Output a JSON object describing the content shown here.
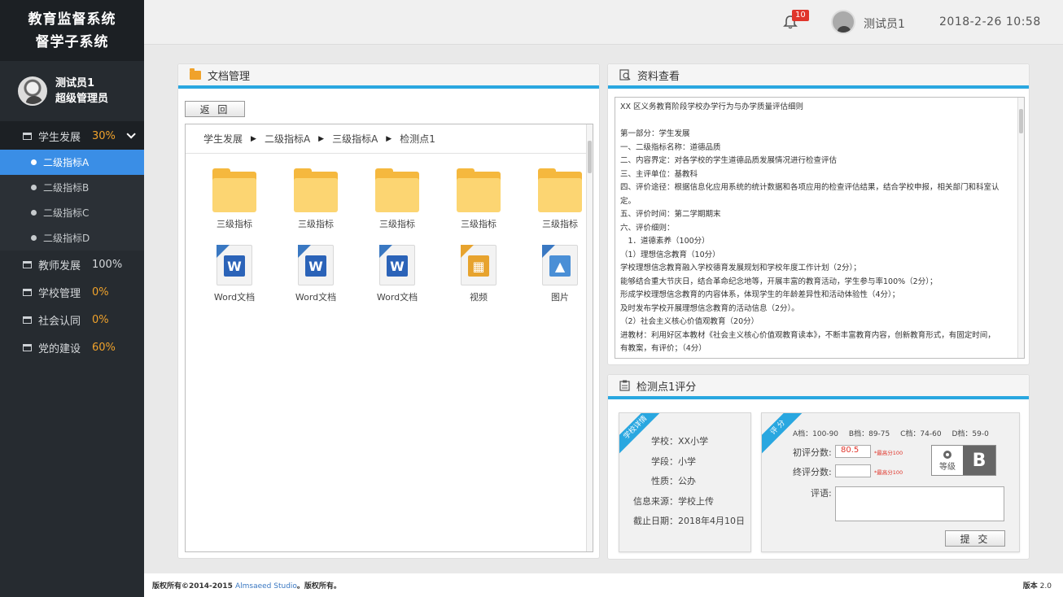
{
  "app": {
    "title_line1": "教育监督系统",
    "title_line2": "督学子系统"
  },
  "user": {
    "name": "测试员1",
    "role": "超级管理员"
  },
  "sidebar": {
    "items": [
      {
        "label": "学生发展",
        "percent": "30%"
      },
      {
        "label": "教师发展",
        "percent": "100%"
      },
      {
        "label": "学校管理",
        "percent": "0%"
      },
      {
        "label": "社会认同",
        "percent": "0%"
      },
      {
        "label": "党的建设",
        "percent": "60%"
      }
    ],
    "sub_items": [
      {
        "label": "二级指标A"
      },
      {
        "label": "二级指标B"
      },
      {
        "label": "二级指标C"
      },
      {
        "label": "二级指标D"
      }
    ]
  },
  "header": {
    "notification_count": "10",
    "user_name": "测试员1",
    "datetime": "2018-2-26  10:58"
  },
  "doc_manager": {
    "title": "文档管理",
    "back_label": "返 回",
    "breadcrumb": [
      "学生发展",
      "二级指标A",
      "三级指标A",
      "检测点1"
    ],
    "breadcrumb_sep": "▶",
    "files": [
      {
        "label": "三级指标",
        "icon": "folder-icon"
      },
      {
        "label": "三级指标",
        "icon": "folder-icon"
      },
      {
        "label": "三级指标",
        "icon": "folder-icon"
      },
      {
        "label": "三级指标",
        "icon": "folder-icon"
      },
      {
        "label": "三级指标",
        "icon": "folder-icon"
      },
      {
        "label": "Word文档",
        "icon": "word-doc-icon"
      },
      {
        "label": "Word文档",
        "icon": "word-doc-icon"
      },
      {
        "label": "Word文档",
        "icon": "word-doc-icon"
      },
      {
        "label": "视频",
        "icon": "video-file-icon"
      },
      {
        "label": "图片",
        "icon": "image-file-icon"
      }
    ]
  },
  "viewer": {
    "title": "资料查看",
    "lines": [
      "XX 区义务教育阶段学校办学行为与办学质量评估细则",
      "",
      "第一部分：学生发展",
      "一、二级指标名称：道德品质",
      "二、内容界定：对各学校的学生道德品质发展情况进行检查评估",
      "三、主评单位：基教科",
      "四、评价途径：根据信息化应用系统的统计数据和各项应用的检查评估结果，结合学校申报，相关部门和科室认定。",
      "五、评价时间：第二学期期末",
      "六、评价细则：",
      "　1．道德素养（100分）",
      "（1）理想信念教育（10分）",
      "学校理想信念教育融入学校德育发展规划和学校年度工作计划（2分）；",
      "能够结合重大节庆日，结合革命纪念地等，开展丰富的教育活动，学生参与率100%（2分）；",
      "形成学校理想信念教育的内容体系，体现学生的年龄差异性和活动体验性（4分）；",
      "及时发布学校开展理想信念教育的活动信息（2分）。",
      "（2）社会主义核心价值观教育（20分）",
      "进教材：利用好区本教材《社会主义核心价值观教育读本》，不断丰富教育内容，创新教育形式，有固定时间，",
      "有教案，有评价；（4分）"
    ]
  },
  "evaluation": {
    "title": "检测点1评分",
    "info_ribbon": "学校详情",
    "info": [
      {
        "key": "学校：",
        "value": "XX小学"
      },
      {
        "key": "学段：",
        "value": "小学"
      },
      {
        "key": "性质：",
        "value": "公办"
      },
      {
        "key": "信息来源：",
        "value": "学校上传"
      },
      {
        "key": "截止日期：",
        "value": "2018年4月10日"
      }
    ],
    "eval_ribbon": "评 分",
    "grades": [
      "A档：100-90",
      "B档：89-75",
      "C档：74-60",
      "D档：59-0"
    ],
    "initial_label": "初评分数:",
    "initial_value": "80.5",
    "initial_hint": "*最高分100",
    "final_label": "终评分数:",
    "final_value": "",
    "final_hint": "*最高分100",
    "level_label": "等级",
    "level_value": "B",
    "comment_label": "评语:",
    "submit_label": "提 交"
  },
  "footer": {
    "copyright_prefix": "版权所有©2014-2015 ",
    "studio": "Almsaeed Studio",
    "copyright_suffix": "。版权所有。",
    "version_label": "版本",
    "version": "2.0"
  },
  "colors": {
    "accent": "#29a7e0",
    "selected": "#3a8ee6",
    "sidebar": "#262b30",
    "percent": "#f0a22b",
    "alert": "#e0352b"
  }
}
